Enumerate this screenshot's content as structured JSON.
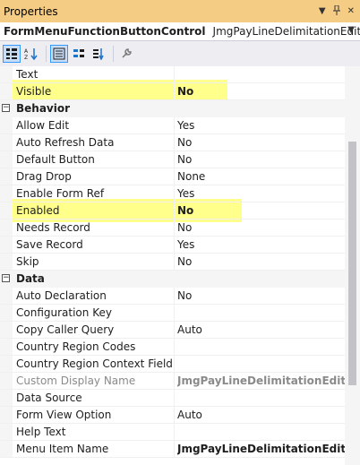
{
  "titlebar": {
    "title": "Properties",
    "icons": [
      "chevron-down-icon",
      "pin-icon",
      "close-icon"
    ]
  },
  "object_selector": {
    "name": "FormMenuFunctionButtonControl",
    "type": "JmgPayLineDelimitationEditor"
  },
  "toolbar": {
    "buttons": [
      "categorized-icon",
      "alphabetical-icon",
      "properties-icon",
      "events-icon",
      "sort-icon",
      "property-pages-icon"
    ]
  },
  "grid": {
    "top_rows": [
      {
        "name": "Text",
        "value": ""
      },
      {
        "name": "Visible",
        "value": "No"
      }
    ],
    "behavior": {
      "label": "Behavior",
      "toggle": "⊟",
      "rows": [
        {
          "name": "Allow Edit",
          "value": "Yes"
        },
        {
          "name": "Auto Refresh Data",
          "value": "No"
        },
        {
          "name": "Default Button",
          "value": "No"
        },
        {
          "name": "Drag Drop",
          "value": "None"
        },
        {
          "name": "Enable Form Ref",
          "value": "Yes"
        },
        {
          "name": "Enabled",
          "value": "No"
        },
        {
          "name": "Needs Record",
          "value": "No"
        },
        {
          "name": "Save Record",
          "value": "Yes"
        },
        {
          "name": "Skip",
          "value": "No"
        }
      ]
    },
    "data": {
      "label": "Data",
      "toggle": "⊟",
      "rows": [
        {
          "name": "Auto Declaration",
          "value": "No"
        },
        {
          "name": "Configuration Key",
          "value": ""
        },
        {
          "name": "Copy Caller Query",
          "value": "Auto"
        },
        {
          "name": "Country Region Codes",
          "value": ""
        },
        {
          "name": "Country Region Context Field",
          "value": ""
        },
        {
          "name": "Custom Display Name",
          "value": "JmgPayLineDelimitationEditor (M"
        },
        {
          "name": "Data Source",
          "value": ""
        },
        {
          "name": "Form View Option",
          "value": "Auto"
        },
        {
          "name": "Help Text",
          "value": ""
        },
        {
          "name": "Menu Item Name",
          "value": "JmgPayLineDelimitationEditor"
        }
      ]
    }
  },
  "colors": {
    "title_bar": "#f5cc84",
    "highlight": "#ffff66",
    "category_bg": "#f5f5f5",
    "toolbar_bg": "#eeeef2"
  }
}
